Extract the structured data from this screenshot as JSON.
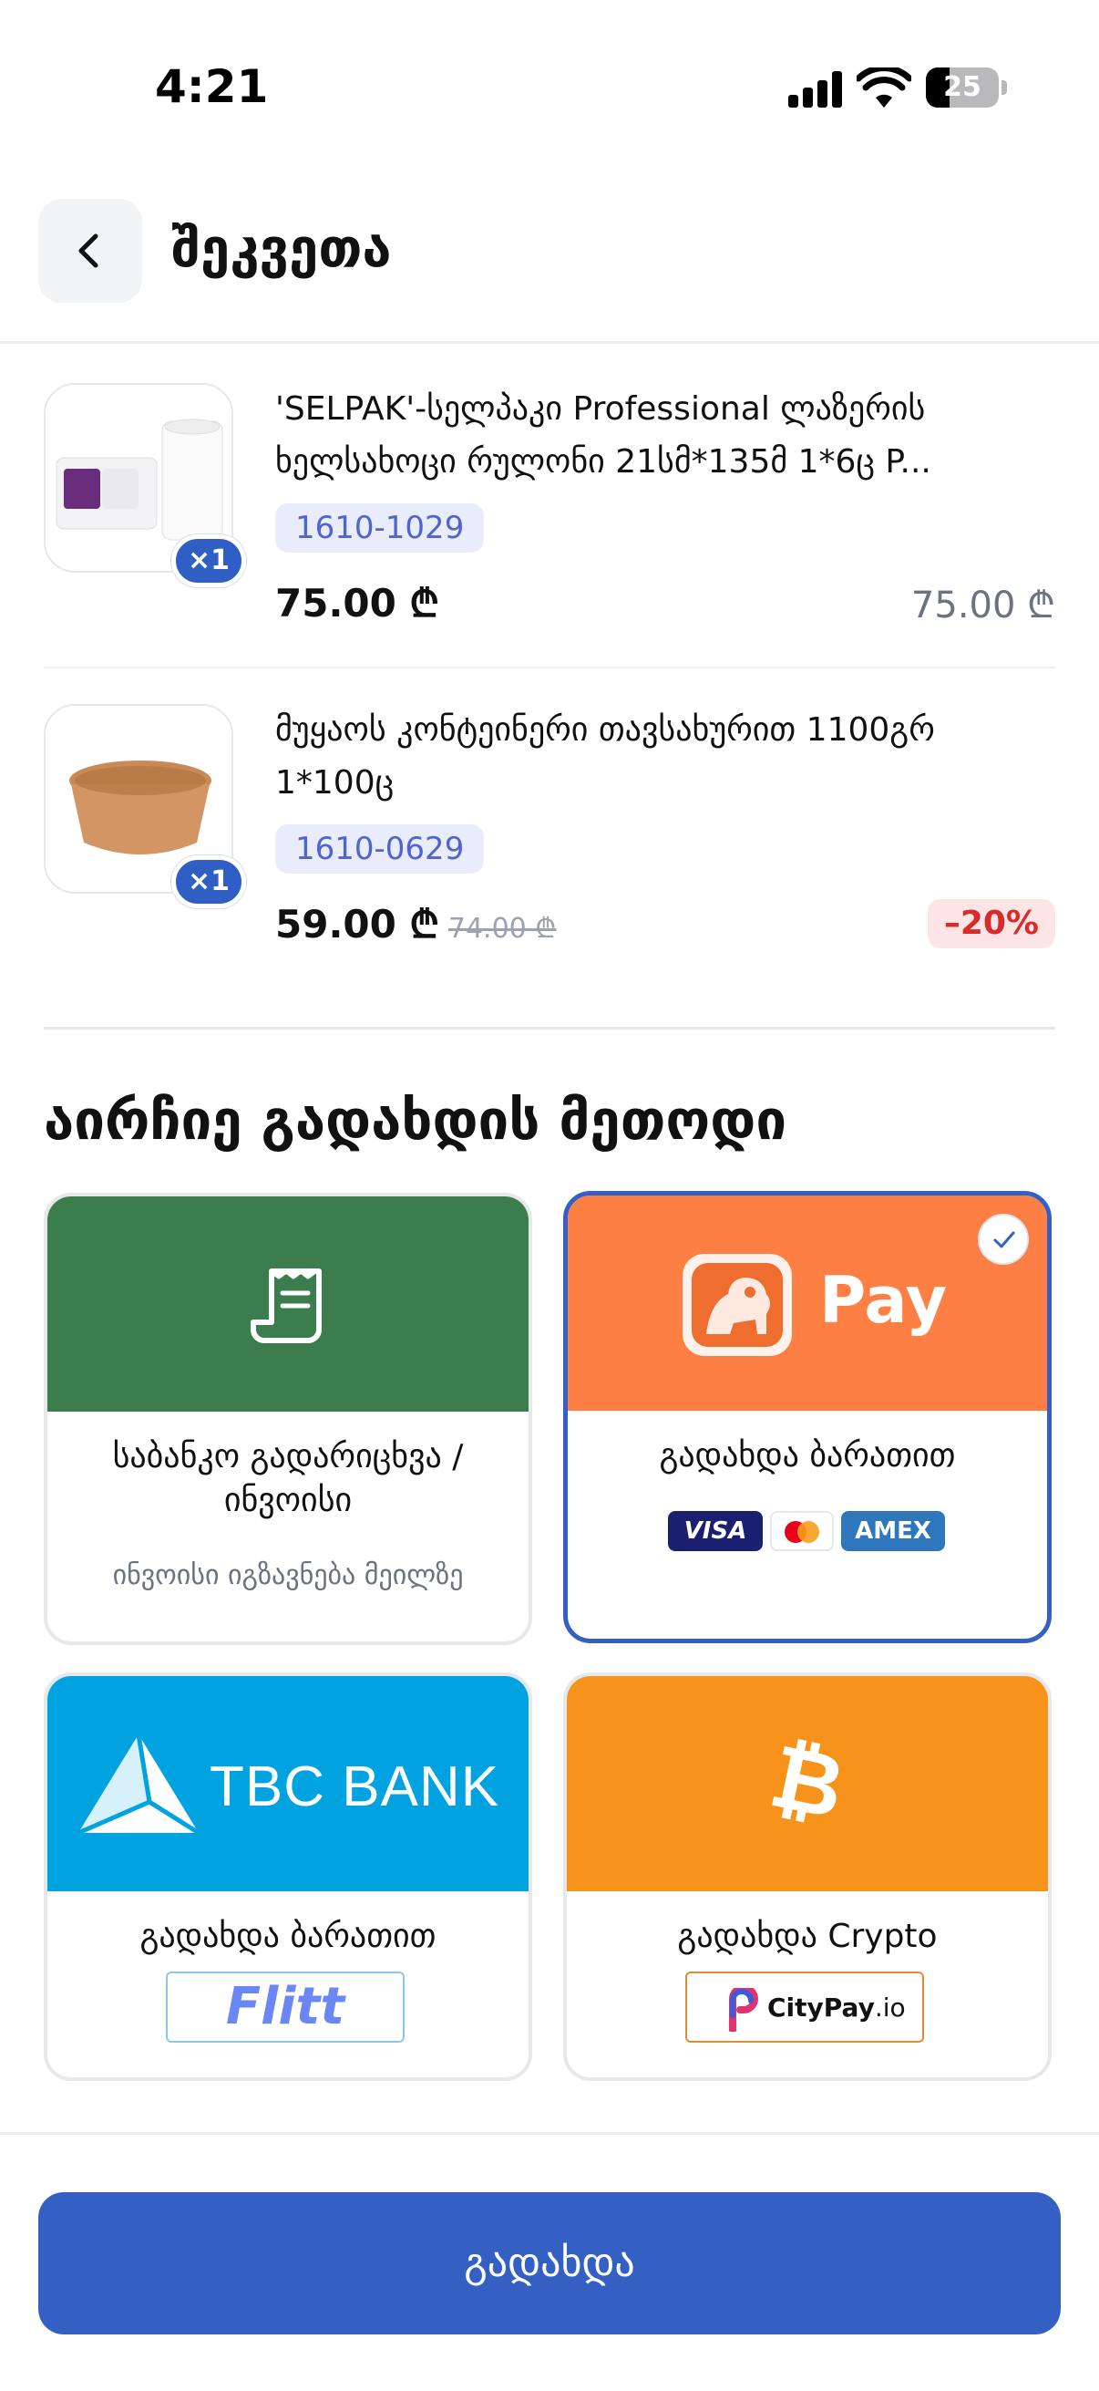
{
  "status_bar": {
    "time": "4:21",
    "battery": "25"
  },
  "header": {
    "title": "შეკვეთა"
  },
  "products": [
    {
      "name": "'SELPAK'-სელპაკი Professional ლაზერის ხელსახოცი რულონი 21სმ*135მ 1*6ც P...",
      "sku": "1610-1029",
      "quantity": "×1",
      "price": "75.00 ₾",
      "total": "75.00 ₾"
    },
    {
      "name": "მუყაოს კონტეინერი თავსახურით 1100გრ 1*100ც",
      "sku": "1610-0629",
      "quantity": "×1",
      "price": "59.00 ₾",
      "old_price": "74.00 ₾",
      "discount": "–20%"
    }
  ],
  "payment": {
    "title": "აირჩიე გადახდის მეთოდი",
    "methods": [
      {
        "label": "საბანკო გადარიცხვა / ინვოისი",
        "note": "ინვოისი იგზავნება მეილზე",
        "color": "#3c7d4e",
        "icon": "receipt-icon"
      },
      {
        "label": "გადახდა ბარათით",
        "logo_text": "Pay",
        "color": "#fe7f44",
        "selected": true,
        "cards": [
          "VISA",
          "AMEX"
        ],
        "icon": "lion-pay-icon"
      },
      {
        "label": "გადახდა ბარათით",
        "logo_text": "TBC BANK",
        "provider": "Flitt",
        "color": "#00a3e0",
        "icon": "tbc-logo-icon"
      },
      {
        "label": "გადახდა Crypto",
        "provider_name": "CityPay",
        "provider_suffix": ".io",
        "color": "#f7931a",
        "icon": "bitcoin-icon"
      }
    ]
  },
  "pay_button": "გადახდა"
}
